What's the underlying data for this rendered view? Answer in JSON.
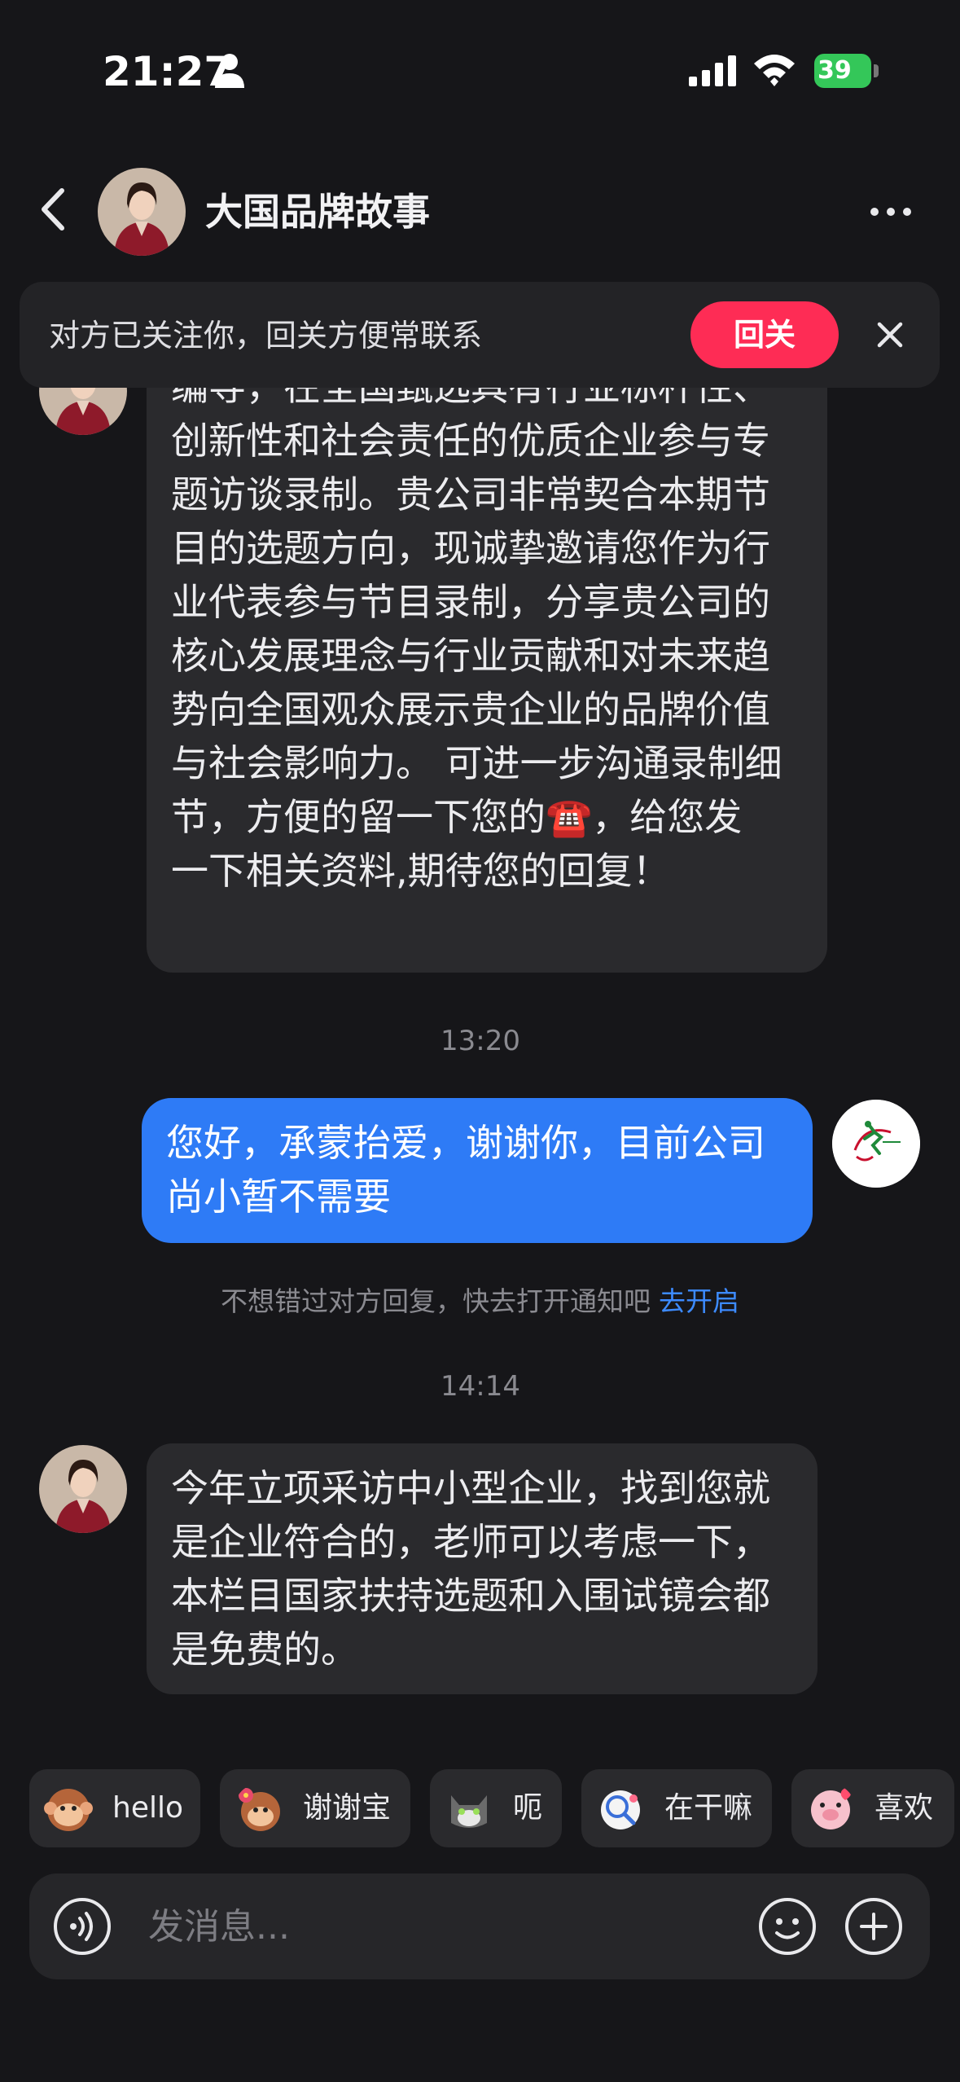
{
  "status_bar": {
    "time": "21:27",
    "battery": "39"
  },
  "header": {
    "title": "大国品牌故事"
  },
  "follow_banner": {
    "text": "对方已关注你，回关方便常联系",
    "button": "回关"
  },
  "messages": [
    {
      "from": "them",
      "text": "您好，我是央媒对话访谈栏目组选题\n编导，在全国甄选具有行业标杆性、\n创新性和社会责任的优质企业参与专\n题访谈录制。贵公司非常契合本期节\n目的选题方向，现诚挚邀请您作为行\n业代表参与节目录制，分享贵公司的\n核心发展理念与行业贡献和对未来趋\n势向全国观众展示贵企业的品牌价值\n与社会影响力。 可进一步沟通录制细\n节，方便的留一下您的☎️，给您发\n一下相关资料,期待您的回复！"
    },
    {
      "timestamp": "13:20"
    },
    {
      "from": "me",
      "text": "您好，承蒙抬爱，谢谢你，目前公司\n尚小暂不需要"
    },
    {
      "notice": "不想错过对方回复，快去打开通知吧",
      "link": "去开启"
    },
    {
      "timestamp": "14:14"
    },
    {
      "from": "them",
      "text": "今年立项采访中小型企业，找到您就\n是企业符合的，老师可以考虑一下，\n本栏目国家扶持选题和入围试镜会都\n是免费的。"
    }
  ],
  "quick_replies": [
    {
      "label": "hello",
      "icon": "monkey-sticker"
    },
    {
      "label": "谢谢宝",
      "icon": "monkey-flower-sticker"
    },
    {
      "label": "呃",
      "icon": "cat-sticker"
    },
    {
      "label": "在干嘛",
      "icon": "magnifier-sticker"
    },
    {
      "label": "喜欢",
      "icon": "pig-sticker"
    }
  ],
  "composer": {
    "placeholder": "发消息..."
  },
  "colors": {
    "accent_red": "#fe2c55",
    "my_bubble": "#2e7bf6",
    "link_blue": "#3d8bff",
    "background": "#161619"
  }
}
